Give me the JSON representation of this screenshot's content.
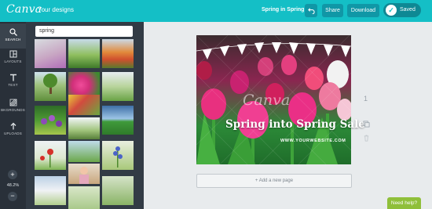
{
  "header": {
    "logo": "Canva",
    "nav_link": "Your designs",
    "doc_title": "Spring in Spring",
    "share_label": "Share",
    "download_label": "Download",
    "saved_label": "Saved"
  },
  "toolbar": {
    "items": [
      {
        "label": "SEARCH",
        "icon": "search-icon",
        "active": true
      },
      {
        "label": "LAYOUTS",
        "icon": "layouts-icon",
        "active": false
      },
      {
        "label": "TEXT",
        "icon": "text-icon",
        "active": false
      },
      {
        "label": "BKGROUNDS",
        "icon": "backgrounds-icon",
        "active": false
      },
      {
        "label": "UPLOADS",
        "icon": "uploads-icon",
        "active": false
      }
    ],
    "zoom_level": "48.2%"
  },
  "search": {
    "value": "spring"
  },
  "design": {
    "watermark": "Canva",
    "headline": "Spring into Spring Sale",
    "website": "WWW.YOURWEBSITE.COM"
  },
  "canvas": {
    "page_number": "1",
    "add_page_label": "+ Add a new page"
  },
  "help": {
    "label": "Need help?"
  },
  "colors": {
    "header": "#14bfc6",
    "toolbar": "#293039",
    "panel": "#323b45",
    "help": "#8fbf3a"
  }
}
